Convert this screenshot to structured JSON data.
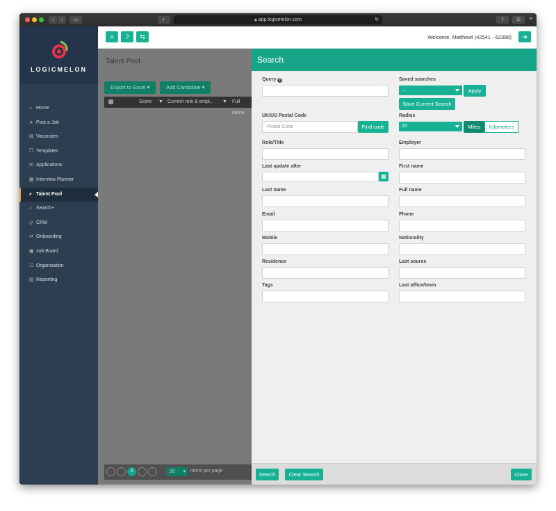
{
  "browser": {
    "url": "app.logicmelon.com"
  },
  "brand": {
    "name": "LOGICMELON"
  },
  "sidebar": {
    "items": [
      {
        "label": "Home",
        "icon": "home-icon",
        "glyph": "⌂"
      },
      {
        "label": "Post a Job",
        "icon": "send-icon",
        "glyph": "➤"
      },
      {
        "label": "Vacancies",
        "icon": "list-icon",
        "glyph": "▤"
      },
      {
        "label": "Templates",
        "icon": "copy-icon",
        "glyph": "❐"
      },
      {
        "label": "Applications",
        "icon": "envelope-icon",
        "glyph": "✉"
      },
      {
        "label": "Interview Planner",
        "icon": "calendar-icon",
        "glyph": "▦"
      },
      {
        "label": "Talent Pool",
        "icon": "search-icon",
        "glyph": "⌕",
        "active": true
      },
      {
        "label": "Search+",
        "icon": "search-plus-icon",
        "glyph": "⌕"
      },
      {
        "label": "CRM",
        "icon": "crm-icon",
        "glyph": "◎"
      },
      {
        "label": "Onboarding",
        "icon": "exchange-icon",
        "glyph": "⇄"
      },
      {
        "label": "Job Board",
        "icon": "book-icon",
        "glyph": "▣"
      },
      {
        "label": "Organisation",
        "icon": "users-icon",
        "glyph": "☷"
      },
      {
        "label": "Reporting",
        "icon": "chart-icon",
        "glyph": "▥"
      }
    ]
  },
  "topbar": {
    "welcome": "Welcome, Matthewl (42541 - 62388)"
  },
  "talent_pool": {
    "title": "Talent Pool",
    "export_label": "Export to Excel ▾",
    "add_label": "Add Candidate ▾",
    "columns": [
      "Score",
      "Current role & empl...",
      "Full name"
    ],
    "page_size": "20",
    "page_number": "0",
    "items_per_page": "items per page"
  },
  "search": {
    "title": "Search",
    "query_label": "Query",
    "saved_searches_label": "Saved searches",
    "saved_searches_value": "...",
    "apply_label": "Apply",
    "save_current_label": "Save Current Search",
    "postal_label": "UK/US Postal Code",
    "postal_placeholder": "Postal Code",
    "find_code_label": "Find code",
    "radius_label": "Radius",
    "radius_value": "20",
    "miles_label": "Miles",
    "km_label": "Kilometers",
    "role_label": "Role/Title",
    "employer_label": "Employer",
    "last_update_label": "Last update after",
    "first_name_label": "First name",
    "last_name_label": "Last name",
    "full_name_label": "Full name",
    "email_label": "Email",
    "phone_label": "Phone",
    "mobile_label": "Mobile",
    "nationality_label": "Nationality",
    "residence_label": "Residence",
    "last_source_label": "Last source",
    "tags_label": "Tags",
    "last_office_label": "Last office/team",
    "search_button": "Search",
    "clear_button": "Clear Search",
    "close_button": "Close"
  },
  "colors": {
    "accent": "#17b193",
    "header": "#17a589",
    "sidebar": "#2c3e50"
  }
}
